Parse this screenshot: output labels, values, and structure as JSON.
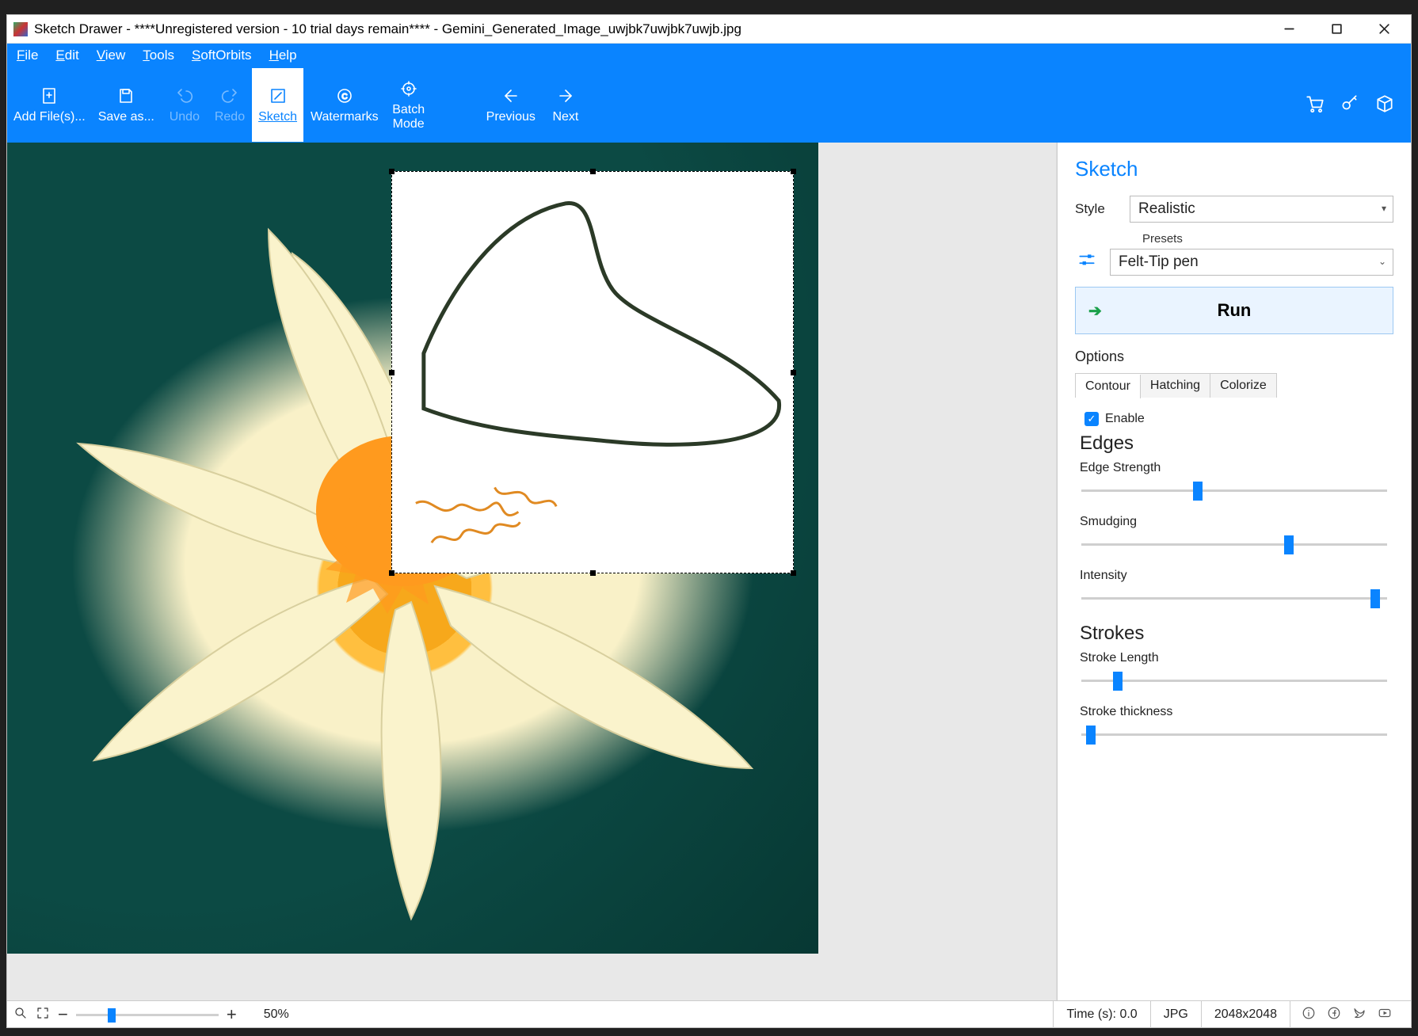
{
  "window": {
    "title": "Sketch Drawer - ****Unregistered version - 10 trial days remain**** - Gemini_Generated_Image_uwjbk7uwjbk7uwjb.jpg"
  },
  "menu": {
    "items": [
      "File",
      "Edit",
      "View",
      "Tools",
      "SoftOrbits",
      "Help"
    ]
  },
  "ribbon": {
    "add": "Add File(s)...",
    "save": "Save as...",
    "undo": "Undo",
    "redo": "Redo",
    "sketch": "Sketch",
    "watermarks": "Watermarks",
    "batch1": "Batch",
    "batch2": "Mode",
    "previous": "Previous",
    "next": "Next"
  },
  "panel": {
    "title": "Sketch",
    "style_label": "Style",
    "style_value": "Realistic",
    "presets_label": "Presets",
    "presets_value": "Felt-Tip pen",
    "run": "Run",
    "options": "Options",
    "tabs": {
      "contour": "Contour",
      "hatching": "Hatching",
      "colorize": "Colorize"
    },
    "enable": "Enable",
    "edges_h": "Edges",
    "edge_strength": "Edge Strength",
    "smudging": "Smudging",
    "intensity": "Intensity",
    "strokes_h": "Strokes",
    "stroke_length": "Stroke Length",
    "stroke_thickness": "Stroke thickness",
    "sliders": {
      "edge_strength": 38,
      "smudging": 68,
      "intensity": 96,
      "stroke_length": 12,
      "stroke_thickness": 3
    }
  },
  "status": {
    "zoom_pct": "50%",
    "time": "Time (s): 0.0",
    "format": "JPG",
    "dims": "2048x2048"
  }
}
